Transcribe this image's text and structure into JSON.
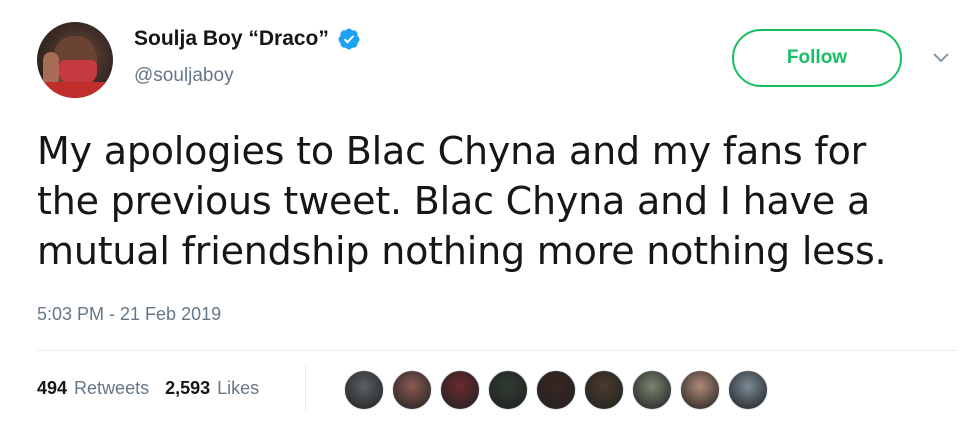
{
  "author": {
    "display_name": "Soulja Boy “Draco”",
    "handle": "@souljaboy",
    "verified": true,
    "avatar_icon": "profile-photo"
  },
  "actions": {
    "follow_label": "Follow",
    "more_icon": "chevron-down-icon"
  },
  "tweet": {
    "text": "My apologies to Blac Chyna and my fans for\nthe previous tweet.  Blac  Chyna and I have a\nmutual friendship nothing more nothing less.",
    "timestamp": "5:03 PM - 21 Feb 2019"
  },
  "stats": {
    "retweets_count": "494",
    "retweets_label": "Retweets",
    "likes_count": "2,593",
    "likes_label": "Likes"
  },
  "likers": [
    {
      "color": "#5b5f63"
    },
    {
      "color": "#8a5a52"
    },
    {
      "color": "#6a2a2e"
    },
    {
      "color": "#2e3b30"
    },
    {
      "color": "#3a2620"
    },
    {
      "color": "#4a3a2c"
    },
    {
      "color": "#7a8470"
    },
    {
      "color": "#b08a78"
    },
    {
      "color": "#7b8a96"
    }
  ],
  "colors": {
    "follow_green": "#17bf63",
    "verified_blue": "#1da1f2",
    "secondary_text": "#657786"
  }
}
